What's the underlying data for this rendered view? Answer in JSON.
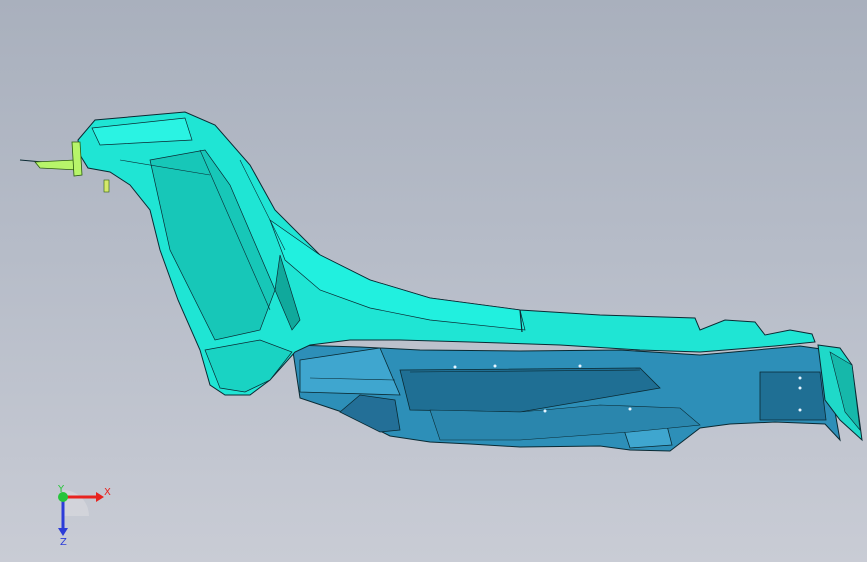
{
  "viewport": {
    "model": {
      "upper_part_color": "#1fe5d4",
      "upper_part_shade": "#17c7b8",
      "lower_part_color": "#2d8fb8",
      "lower_part_shade": "#1f6f94",
      "edge_color": "#0a2a33",
      "accent_color": "#b7f56a"
    },
    "triad": {
      "x_label": "X",
      "y_label": "Y",
      "z_label": "Z",
      "x_color": "#e8231f",
      "y_color": "#27c53b",
      "z_color": "#2c3cd8"
    }
  }
}
